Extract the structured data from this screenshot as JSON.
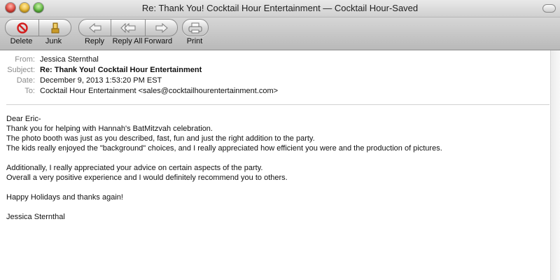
{
  "window": {
    "title": "Re: Thank You! Cocktail Hour Entertainment — Cocktail Hour-Saved"
  },
  "toolbar": {
    "delete_label": "Delete",
    "junk_label": "Junk",
    "reply_label": "Reply",
    "reply_all_label": "Reply All",
    "forward_label": "Forward",
    "print_label": "Print"
  },
  "headers": {
    "from_key": "From:",
    "from": "Jessica Sternthal",
    "subject_key": "Subject:",
    "subject": "Re: Thank You! Cocktail Hour Entertainment",
    "date_key": "Date:",
    "date": "December 9, 2013 1:53:20 PM EST",
    "to_key": "To:",
    "to": "Cocktail Hour Entertainment <sales@cocktailhourentertainment.com>"
  },
  "body": {
    "lines": [
      "Dear Eric-",
      "Thank you for helping with Hannah's BatMitzvah celebration.",
      "The photo booth was just as you described, fast, fun and just the right addition to the party.",
      "The kids really enjoyed the \"background\" choices, and I really appreciated how efficient you were and the production of pictures.",
      "",
      "Additionally, I really appreciated your advice on certain aspects of the party.",
      "Overall a very positive experience and I would definitely recommend you to others.",
      "",
      "Happy Holidays and thanks again!",
      "",
      "Jessica Sternthal"
    ]
  }
}
